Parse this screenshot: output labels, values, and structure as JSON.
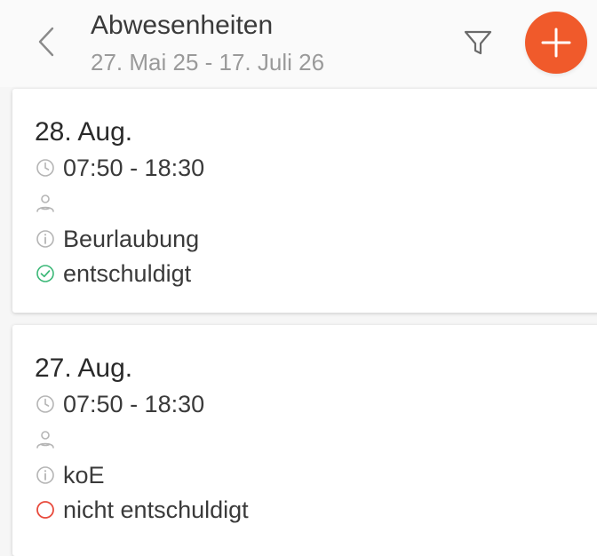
{
  "header": {
    "title": "Abwesenheiten",
    "subtitle": "27. Mai 25 - 17. Juli 26"
  },
  "absences": [
    {
      "date": "28. Aug.",
      "time": "07:50 - 18:30",
      "reason": "Beurlaubung",
      "status": "entschuldigt",
      "status_icon": "check-circle-icon",
      "status_color": "#3cb878"
    },
    {
      "date": "27. Aug.",
      "time": "07:50 - 18:30",
      "reason": "koE",
      "status": "nicht entschuldigt",
      "status_icon": "empty-circle-icon",
      "status_color": "#e84a3c"
    }
  ],
  "colors": {
    "accent": "#f05a2b",
    "muted_text": "#9a9a9a",
    "icon_gray": "#b5b5b5"
  }
}
